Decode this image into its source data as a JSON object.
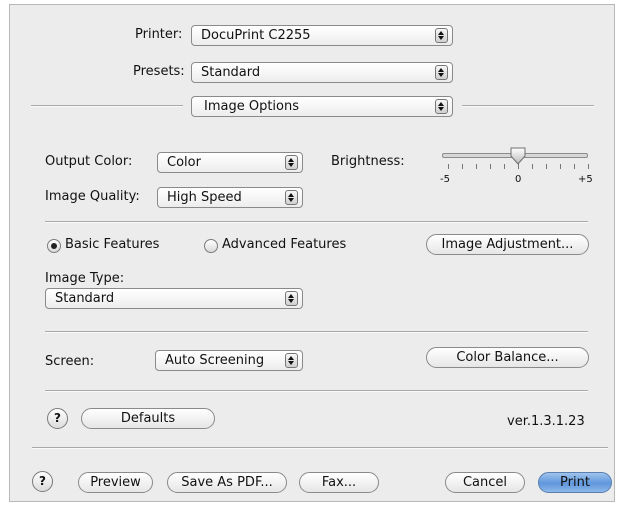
{
  "printer": {
    "label": "Printer:",
    "value": "DocuPrint C2255"
  },
  "presets": {
    "label": "Presets:",
    "value": "Standard"
  },
  "pane": {
    "value": "Image Options"
  },
  "output_color": {
    "label": "Output Color:",
    "value": "Color"
  },
  "image_quality": {
    "label": "Image Quality:",
    "value": "High Speed"
  },
  "brightness": {
    "label": "Brightness:",
    "min_label": "-5",
    "mid_label": "0",
    "max_label": "+5",
    "min": -5,
    "max": 5,
    "value": 0
  },
  "features": {
    "basic": "Basic Features",
    "advanced": "Advanced Features",
    "selected": "basic"
  },
  "image_adjustment_button": "Image Adjustment...",
  "image_type": {
    "label": "Image Type:",
    "value": "Standard"
  },
  "screen": {
    "label": "Screen:",
    "value": "Auto Screening"
  },
  "color_balance_button": "Color Balance...",
  "defaults_button": "Defaults",
  "version": "ver.1.3.1.23",
  "footer": {
    "preview": "Preview",
    "save_pdf": "Save As PDF...",
    "fax": "Fax...",
    "cancel": "Cancel",
    "print": "Print"
  },
  "help_glyph": "?"
}
